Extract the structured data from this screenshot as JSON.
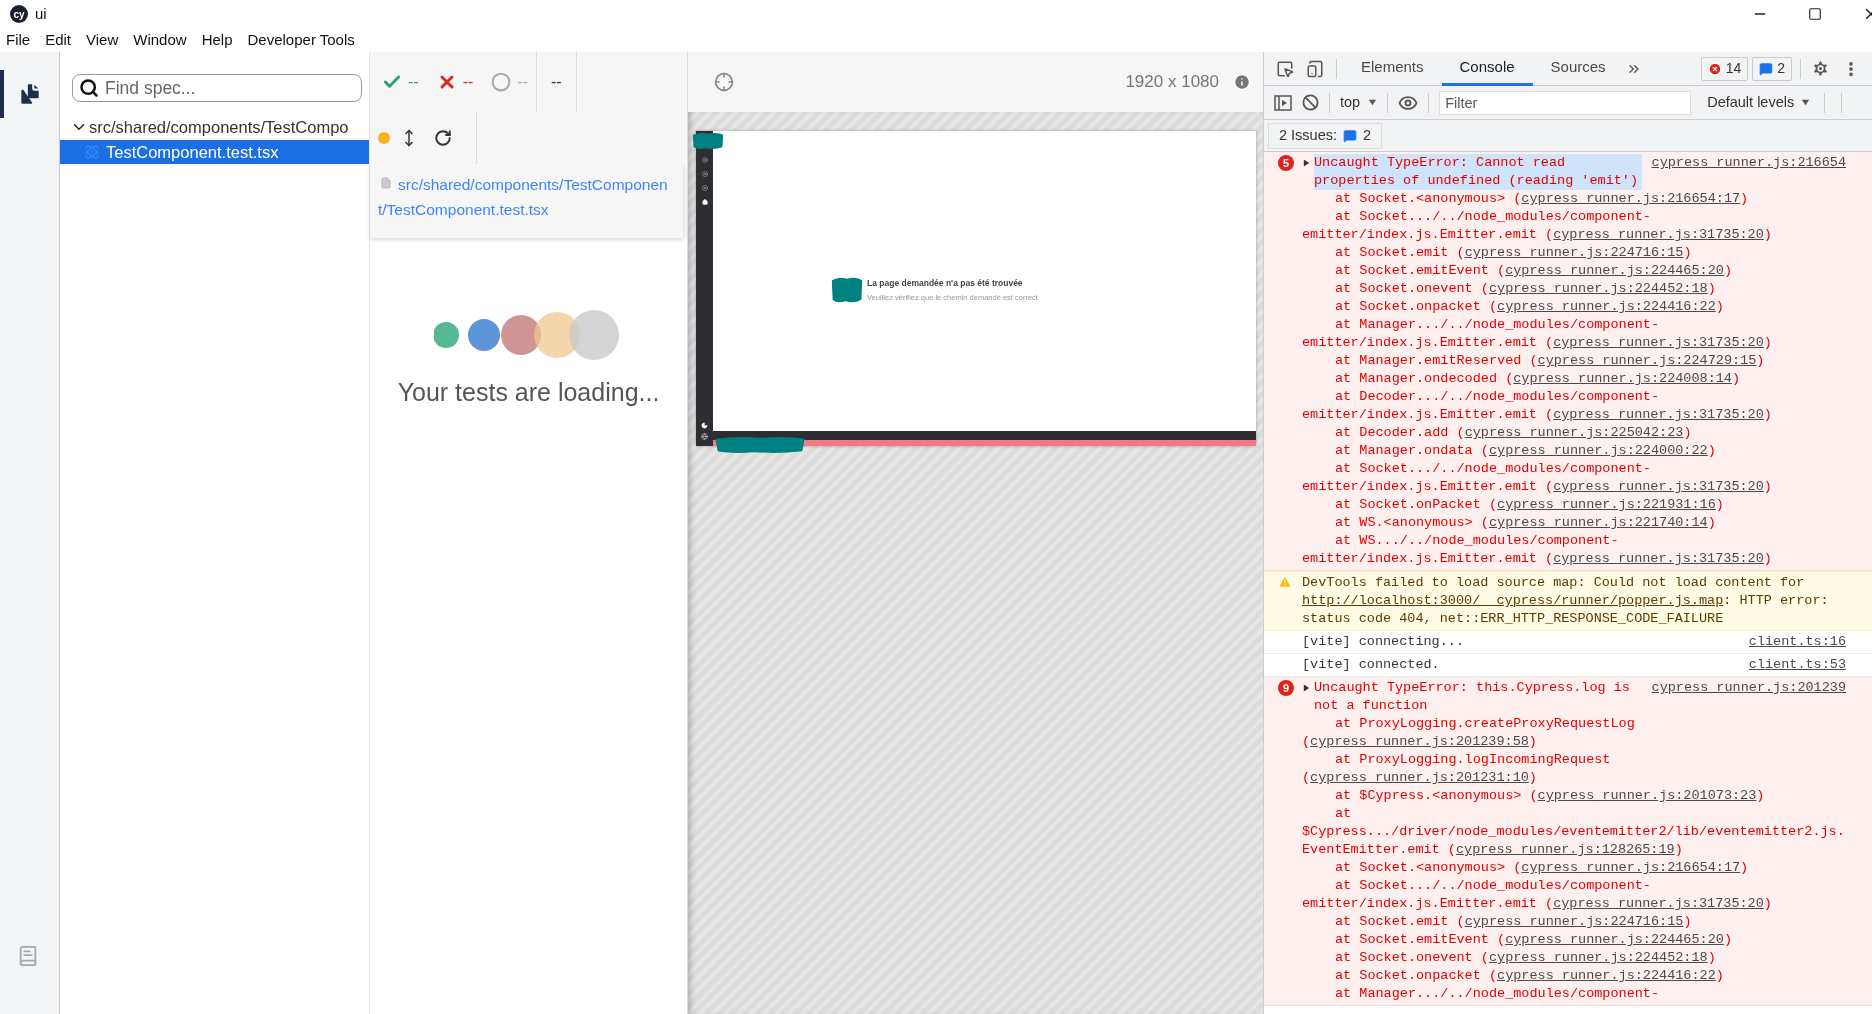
{
  "window": {
    "logo_text": "cy",
    "title": "ui"
  },
  "menu": [
    "File",
    "Edit",
    "View",
    "Window",
    "Help",
    "Developer Tools"
  ],
  "specs": {
    "search": {
      "placeholder": "Find spec..."
    },
    "tree": [
      {
        "label": "src/shared/components/TestCompo",
        "expanded": true,
        "children": [
          {
            "label": "TestComponent.test.tsx",
            "selected": true
          }
        ]
      }
    ]
  },
  "reporter": {
    "passed": "--",
    "failed": "--",
    "pending": "--",
    "duration": "--",
    "spec_path": "src/shared/components/TestComponent/TestComponent.test.tsx",
    "loading_text": "Your tests are loading..."
  },
  "preview": {
    "viewport": "1920 x 1080",
    "app": {
      "title": "La page demandée n'a pas été trouvée",
      "subtitle": "Veuillez vérifiez que le chemin demandé est correct"
    }
  },
  "devtools": {
    "tabs": [
      {
        "label": "Elements",
        "selected": false
      },
      {
        "label": "Console",
        "selected": true
      },
      {
        "label": "Sources",
        "selected": false
      }
    ],
    "error_count": "14",
    "issue_count": "2",
    "context": "top",
    "filter": {
      "placeholder": "Filter"
    },
    "levels": "Default levels",
    "issues": {
      "label": "2 Issues:",
      "count": "2"
    },
    "messages": [
      {
        "kind": "error",
        "count": "5",
        "expanded": false,
        "highlighted": true,
        "text": "Uncaught TypeError: Cannot read properties of undefined (reading 'emit')",
        "source": "cypress_runner.js:216654",
        "frames": [
          {
            "prefix": "at Socket.<anonymous> (",
            "link": "cypress_runner.js:216654:17",
            "suffix": ")"
          },
          {
            "prefix": "at Socket.../../node_modules/component-emitter/index.js.Emitter.emit (",
            "link": "cypress_runner.js:31735:20",
            "suffix": ")"
          },
          {
            "prefix": "at Socket.emit (",
            "link": "cypress_runner.js:224716:15",
            "suffix": ")"
          },
          {
            "prefix": "at Socket.emitEvent (",
            "link": "cypress_runner.js:224465:20",
            "suffix": ")"
          },
          {
            "prefix": "at Socket.onevent (",
            "link": "cypress_runner.js:224452:18",
            "suffix": ")"
          },
          {
            "prefix": "at Socket.onpacket (",
            "link": "cypress_runner.js:224416:22",
            "suffix": ")"
          },
          {
            "prefix": "at Manager.../../node_modules/component-emitter/index.js.Emitter.emit (",
            "link": "cypress_runner.js:31735:20",
            "suffix": ")"
          },
          {
            "prefix": "at Manager.emitReserved (",
            "link": "cypress_runner.js:224729:15",
            "suffix": ")"
          },
          {
            "prefix": "at Manager.ondecoded (",
            "link": "cypress_runner.js:224008:14",
            "suffix": ")"
          },
          {
            "prefix": "at Decoder.../../node_modules/component-emitter/index.js.Emitter.emit (",
            "link": "cypress_runner.js:31735:20",
            "suffix": ")"
          },
          {
            "prefix": "at Decoder.add (",
            "link": "cypress_runner.js:225042:23",
            "suffix": ")"
          },
          {
            "prefix": "at Manager.ondata (",
            "link": "cypress_runner.js:224000:22",
            "suffix": ")"
          },
          {
            "prefix": "at Socket.../../node_modules/component-emitter/index.js.Emitter.emit (",
            "link": "cypress_runner.js:31735:20",
            "suffix": ")"
          },
          {
            "prefix": "at Socket.onPacket (",
            "link": "cypress_runner.js:221931:16",
            "suffix": ")"
          },
          {
            "prefix": "at WS.<anonymous> (",
            "link": "cypress_runner.js:221740:14",
            "suffix": ")"
          },
          {
            "prefix": "at WS.../../node_modules/component-emitter/index.js.Emitter.emit (",
            "link": "cypress_runner.js:31735:20",
            "suffix": ")"
          }
        ]
      },
      {
        "kind": "warning",
        "text": "DevTools failed to load source map: Could not load content for ",
        "link": "http://localhost:3000/__cypress/runner/popper.js.map",
        "text_after": ": HTTP error: status code 404, net::ERR_HTTP_RESPONSE_CODE_FAILURE"
      },
      {
        "kind": "log",
        "text": "[vite] connecting...",
        "source": "client.ts:16"
      },
      {
        "kind": "log",
        "text": "[vite] connected.",
        "source": "client.ts:53"
      },
      {
        "kind": "error",
        "count": "9",
        "expanded": false,
        "highlighted": false,
        "text": "Uncaught TypeError: this.Cypress.log is not a function",
        "source": "cypress_runner.js:201239",
        "frames": [
          {
            "prefix": "at ProxyLogging.createProxyRequestLog (",
            "link": "cypress_runner.js:201239:58",
            "suffix": ")"
          },
          {
            "prefix": "at ProxyLogging.logIncomingRequest (",
            "link": "cypress_runner.js:201231:10",
            "suffix": ")"
          },
          {
            "prefix": "at $Cypress.<anonymous> (",
            "link": "cypress_runner.js:201073:23",
            "suffix": ")"
          },
          {
            "prefix": "at $Cypress.../driver/node_modules/eventemitter2/lib/eventemitter2.js.EventEmitter.emit (",
            "link": "cypress_runner.js:128265:19",
            "suffix": ")"
          },
          {
            "prefix": "at Socket.<anonymous> (",
            "link": "cypress_runner.js:216654:17",
            "suffix": ")"
          },
          {
            "prefix": "at Socket.../../node_modules/component-emitter/index.js.Emitter.emit (",
            "link": "cypress_runner.js:31735:20",
            "suffix": ")"
          },
          {
            "prefix": "at Socket.emit (",
            "link": "cypress_runner.js:224716:15",
            "suffix": ")"
          },
          {
            "prefix": "at Socket.emitEvent (",
            "link": "cypress_runner.js:224465:20",
            "suffix": ")"
          },
          {
            "prefix": "at Socket.onevent (",
            "link": "cypress_runner.js:224452:18",
            "suffix": ")"
          },
          {
            "prefix": "at Socket.onpacket (",
            "link": "cypress_runner.js:224416:22",
            "suffix": ")"
          },
          {
            "prefix": "at Manager.../../node_modules/component-"
          }
        ]
      }
    ]
  }
}
